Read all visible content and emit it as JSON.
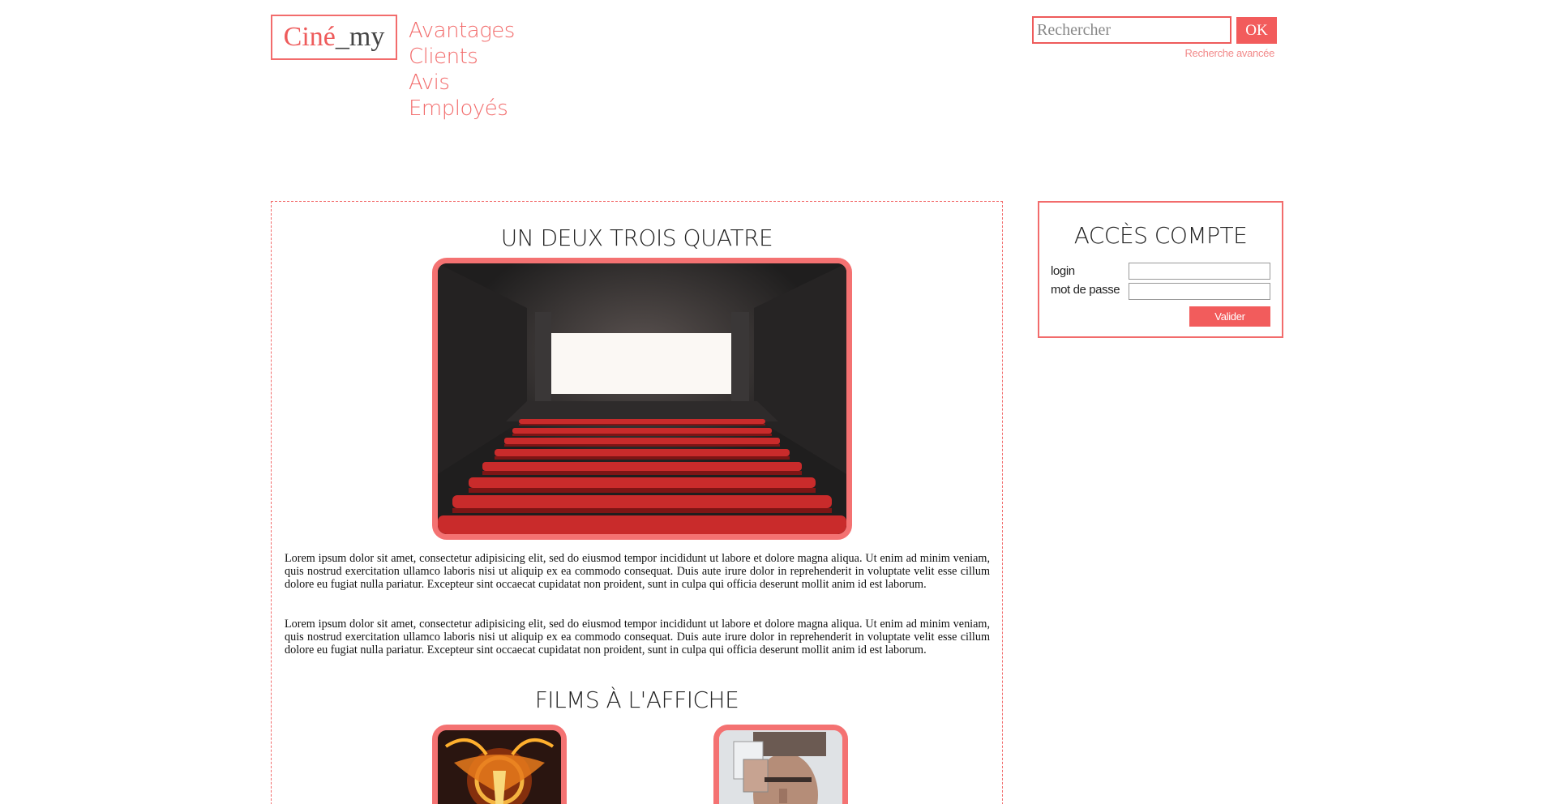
{
  "logo": {
    "part1": "Ciné",
    "part2": "_my"
  },
  "nav": {
    "items": [
      "Avantages",
      "Clients",
      "Avis",
      "Employés"
    ]
  },
  "search": {
    "placeholder": "Rechercher",
    "button": "OK",
    "advanced_link": "Recherche avancée"
  },
  "main": {
    "title": "UN DEUX TROIS QUATRE",
    "paragraphs": [
      "Lorem ipsum dolor sit amet, consectetur adipisicing elit, sed do eiusmod tempor incididunt ut labore et dolore magna aliqua. Ut enim ad minim veniam, quis nostrud exercitation ullamco laboris nisi ut aliquip ex ea commodo consequat. Duis aute irure dolor in reprehenderit in voluptate velit esse cillum dolore eu fugiat nulla pariatur. Excepteur sint occaecat cupidatat non proident, sunt in culpa qui officia deserunt mollit anim id est laborum.",
      "Lorem ipsum dolor sit amet, consectetur adipisicing elit, sed do eiusmod tempor incididunt ut labore et dolore magna aliqua. Ut enim ad minim veniam, quis nostrud exercitation ullamco laboris nisi ut aliquip ex ea commodo consequat. Duis aute irure dolor in reprehenderit in voluptate velit esse cillum dolore eu fugiat nulla pariatur. Excepteur sint occaecat cupidatat non proident, sunt in culpa qui officia deserunt mollit anim id est laborum."
    ],
    "films_title": "FILMS À L'AFFICHE"
  },
  "account": {
    "title": "ACCÈS COMPTE",
    "login_label": "login",
    "password_label": "mot de passe",
    "submit": "Valider"
  },
  "colors": {
    "accent": "#f25c5c",
    "border": "#f26c6c",
    "seats": "#c92b2b"
  },
  "icons": {
    "hero_image": "cinema-hall-image",
    "poster1": "flaming-bird-poster",
    "poster2": "portrait-poster"
  }
}
